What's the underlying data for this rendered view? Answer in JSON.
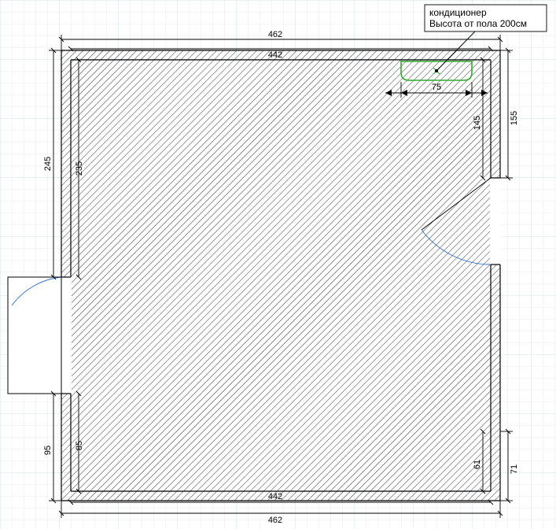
{
  "callout": {
    "line1": "кондиционер",
    "line2": "Высота от пола 200см"
  },
  "dims": {
    "outer_top": "462",
    "inner_top": "442",
    "outer_bottom": "462",
    "inner_bottom": "442",
    "left_outer_upper": "245",
    "left_inner_upper": "235",
    "left_outer_lower": "95",
    "left_inner_lower": "85",
    "right_outer_upper": "155",
    "right_inner_upper": "145",
    "right_outer_lower": "71",
    "right_inner_lower": "61",
    "ac_width": "75"
  },
  "chart_data": {
    "type": "diagram",
    "description": "Architectural floor plan of a roughly square room with hatched walls, door openings on left and right walls, and a ceiling-mounted air conditioner near the top-right corner.",
    "units": "centimeters",
    "outer_wall": {
      "width_cm": 462,
      "height_cm_approx": 462
    },
    "inner_wall": {
      "width_cm": 442,
      "height_cm_approx": 442
    },
    "left_wall_segments_outer_cm": {
      "upper": 245,
      "lower": 95
    },
    "left_wall_segments_inner_cm": {
      "upper": 235,
      "lower": 85
    },
    "right_wall_segments_outer_cm": {
      "upper": 155,
      "lower": 71
    },
    "right_wall_segments_inner_cm": {
      "upper": 145,
      "lower": 61
    },
    "air_conditioner": {
      "width_cm": 75,
      "height_from_floor_cm": 200,
      "location": "top-right interior wall"
    },
    "doors": [
      {
        "wall": "left",
        "swing": "outward",
        "position": "between upper and lower left segments"
      },
      {
        "wall": "right",
        "swing": "inward",
        "position": "below upper right segment"
      }
    ]
  }
}
